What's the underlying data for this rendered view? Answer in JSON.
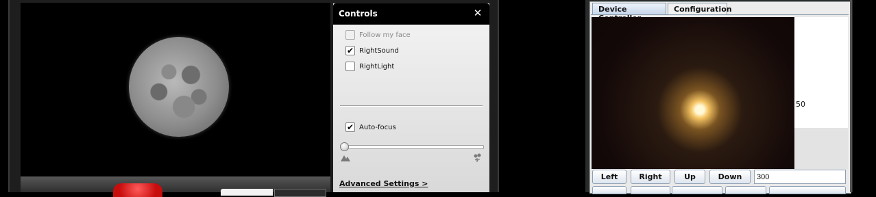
{
  "webcam": {
    "controls_panel": {
      "title": "Controls",
      "options": [
        {
          "label": "Follow my face",
          "checked": false,
          "enabled": false
        },
        {
          "label": "RightSound",
          "checked": true,
          "enabled": true
        },
        {
          "label": "RightLight",
          "checked": false,
          "enabled": true
        }
      ],
      "autofocus": {
        "label": "Auto-focus",
        "checked": true
      },
      "focus_slider_value": 0,
      "advanced_link": "Advanced Settings >"
    },
    "colors": {
      "record_button": "#d11818"
    }
  },
  "device_controller": {
    "tabs": [
      {
        "label": "Device Controller",
        "active": true
      },
      {
        "label": "Configuration",
        "active": false
      }
    ],
    "side_value": "50",
    "buttons": {
      "left": "Left",
      "right": "Right",
      "up": "Up",
      "down": "Down"
    },
    "step_value": "300"
  },
  "check_glyph": "✔",
  "close_glyph": "✕"
}
